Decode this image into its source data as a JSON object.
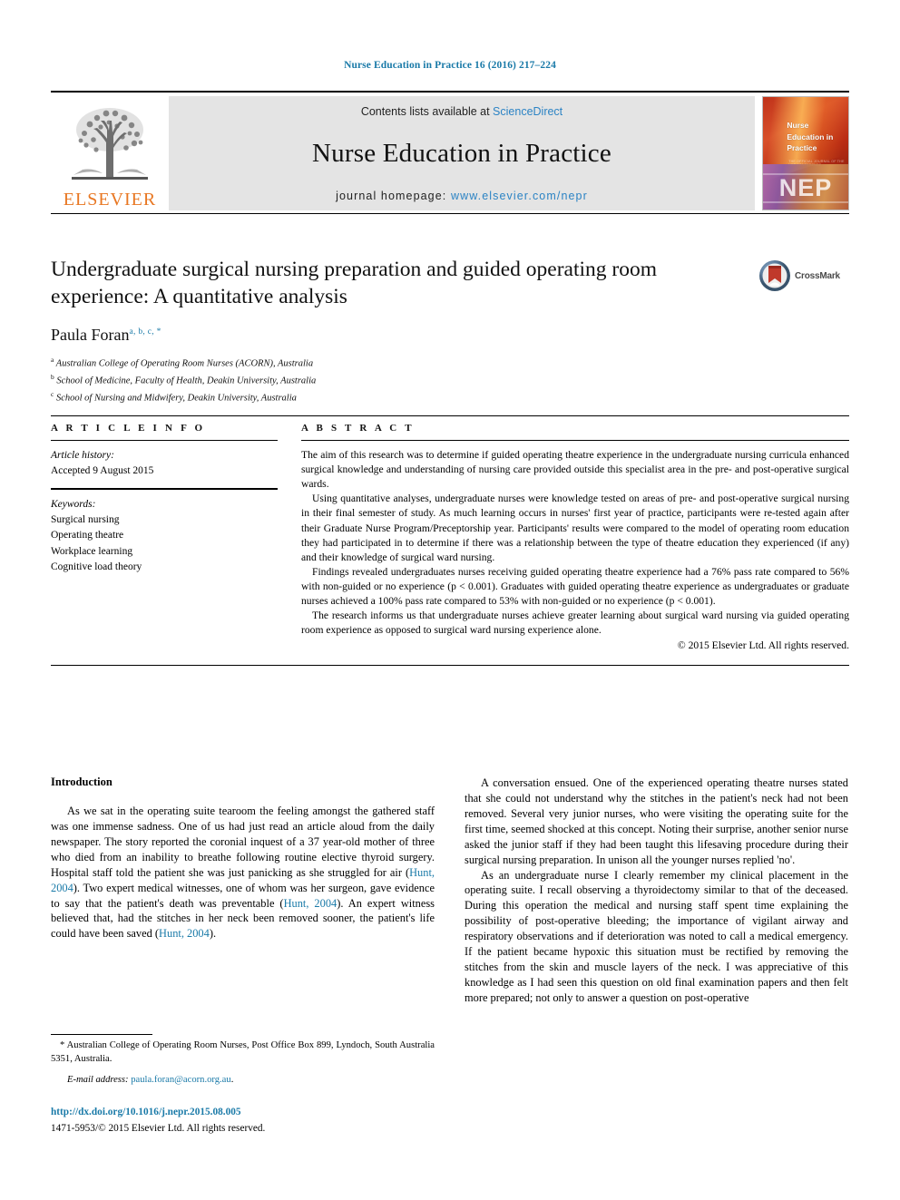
{
  "running_head": "Nurse Education in Practice 16 (2016) 217–224",
  "journal_header": {
    "publisher_logo_text": "ELSEVIER",
    "contents_prefix": "Contents lists available at ",
    "contents_link": "ScienceDirect",
    "journal_name": "Nurse Education in Practice",
    "homepage_prefix": "journal homepage: ",
    "homepage_url": "www.elsevier.com/nepr",
    "cover_title_lines": [
      "Nurse",
      "Education in",
      "Practice"
    ],
    "cover_subtitle": "THE OFFICIAL JOURNAL OF THE NET CONFERENCE",
    "cover_acronym": "NEP"
  },
  "crossmark": {
    "label": "CrossMark",
    "icon": "crossmark-icon"
  },
  "article": {
    "title": "Undergraduate surgical nursing preparation and guided operating room experience: A quantitative analysis",
    "author_name": "Paula Foran",
    "author_marks": "a, b, c, *",
    "affiliations": [
      {
        "mark": "a",
        "text": "Australian College of Operating Room Nurses (ACORN), Australia"
      },
      {
        "mark": "b",
        "text": "School of Medicine, Faculty of Health, Deakin University, Australia"
      },
      {
        "mark": "c",
        "text": "School of Nursing and Midwifery, Deakin University, Australia"
      }
    ]
  },
  "article_info": {
    "heading": "A R T I C L E   I N F O",
    "history_label": "Article history:",
    "history_value": "Accepted 9 August 2015",
    "keywords_label": "Keywords:",
    "keywords": [
      "Surgical nursing",
      "Operating theatre",
      "Workplace learning",
      "Cognitive load theory"
    ]
  },
  "abstract": {
    "heading": "A B S T R A C T",
    "paragraphs": [
      "The aim of this research was to determine if guided operating theatre experience in the undergraduate nursing curricula enhanced surgical knowledge and understanding of nursing care provided outside this specialist area in the pre- and post-operative surgical wards.",
      "Using quantitative analyses, undergraduate nurses were knowledge tested on areas of pre- and post-operative surgical nursing in their final semester of study. As much learning occurs in nurses' first year of practice, participants were re-tested again after their Graduate Nurse Program/Preceptorship year. Participants' results were compared to the model of operating room education they had participated in to determine if there was a relationship between the type of theatre education they experienced (if any) and their knowledge of surgical ward nursing.",
      "Findings revealed undergraduates nurses receiving guided operating theatre experience had a 76% pass rate compared to 56% with non-guided or no experience (p < 0.001). Graduates with guided operating theatre experience as undergraduates or graduate nurses achieved a 100% pass rate compared to 53% with non-guided or no experience (p < 0.001).",
      "The research informs us that undergraduate nurses achieve greater learning about surgical ward nursing via guided operating room experience as opposed to surgical ward nursing experience alone."
    ],
    "copyright": "© 2015 Elsevier Ltd. All rights reserved."
  },
  "body": {
    "intro_heading": "Introduction",
    "left_paragraph_1_a": "As we sat in the operating suite tearoom the feeling amongst the gathered staff was one immense sadness. One of us had just read an article aloud from the daily newspaper. The story reported the coronial inquest of a 37 year-old mother of three who died from an inability to breathe following routine elective thyroid surgery. Hospital staff told the patient she was just panicking as she struggled for air (",
    "cite_1": "Hunt, 2004",
    "left_paragraph_1_b": "). Two expert medical witnesses, one of whom was her surgeon, gave evidence to say that the patient's death was preventable (",
    "cite_2": "Hunt, 2004",
    "left_paragraph_1_c": "). An expert witness believed that, had the stitches in her neck been removed sooner, the patient's life could have been saved (",
    "cite_3": "Hunt, 2004",
    "left_paragraph_1_d": ").",
    "right_paragraph_1": "A conversation ensued. One of the experienced operating theatre nurses stated that she could not understand why the stitches in the patient's neck had not been removed. Several very junior nurses, who were visiting the operating suite for the first time, seemed shocked at this concept. Noting their surprise, another senior nurse asked the junior staff if they had been taught this lifesaving procedure during their surgical nursing preparation. In unison all the younger nurses replied 'no'.",
    "right_paragraph_2": "As an undergraduate nurse I clearly remember my clinical placement in the operating suite. I recall observing a thyroidectomy similar to that of the deceased. During this operation the medical and nursing staff spent time explaining the possibility of post-operative bleeding; the importance of vigilant airway and respiratory observations and if deterioration was noted to call a medical emergency. If the patient became hypoxic this situation must be rectified by removing the stitches from the skin and muscle layers of the neck. I was appreciative of this knowledge as I had seen this question on old final examination papers and then felt more prepared; not only to answer a question on post-operative"
  },
  "footnote": {
    "marker": "*",
    "correspondence": "Australian College of Operating Room Nurses, Post Office Box 899, Lyndoch, South Australia 5351, Australia.",
    "email_label": "E-mail address:",
    "email": "paula.foran@acorn.org.au",
    "email_suffix": "."
  },
  "footer": {
    "doi": "http://dx.doi.org/10.1016/j.nepr.2015.08.005",
    "issn_line": "1471-5953/© 2015 Elsevier Ltd. All rights reserved."
  },
  "colors": {
    "link": "#1a7aa8",
    "sciencedirect": "#2b83c4",
    "elsevier_orange": "#E87722",
    "header_band_bg": "#e4e4e4"
  }
}
